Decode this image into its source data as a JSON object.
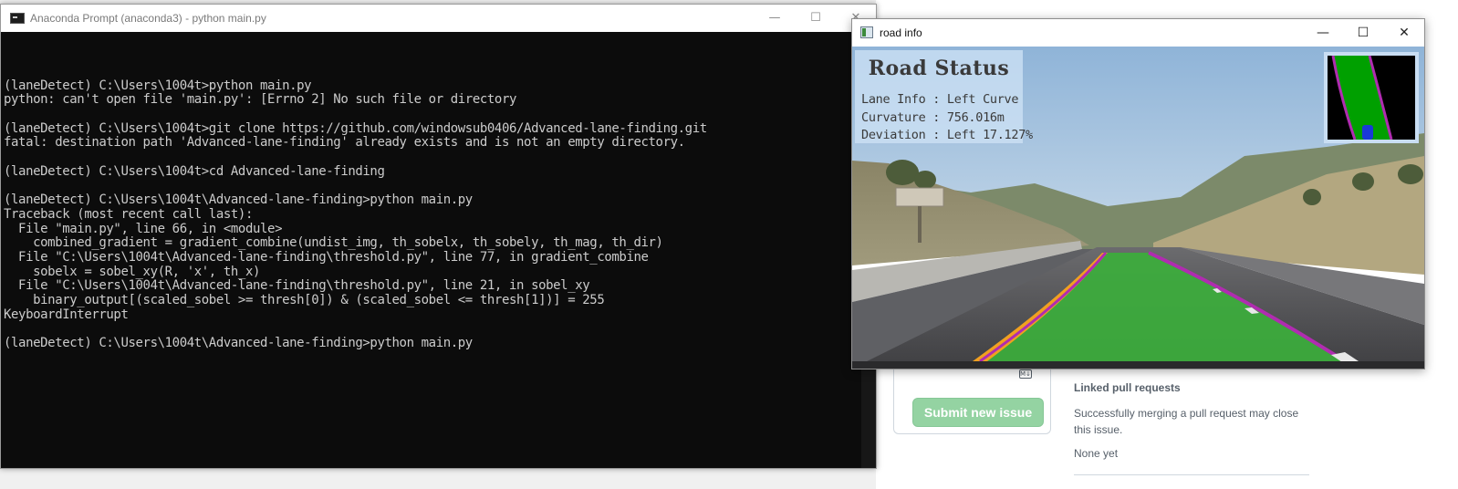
{
  "github": {
    "markdown_icon": "markdown-icon",
    "submit_label": "Submit new issue",
    "linked_pr_title": "Linked pull requests",
    "linked_pr_desc": "Successfully merging a pull request may close this issue.",
    "linked_pr_none": "None yet"
  },
  "console": {
    "title": "Anaconda Prompt (anaconda3) - python  main.py",
    "buttons": {
      "minimize": "—",
      "maximize": "☐",
      "close": "✕"
    },
    "lines": [
      "",
      "(laneDetect) C:\\Users\\1004t>python main.py",
      "python: can't open file 'main.py': [Errno 2] No such file or directory",
      "",
      "(laneDetect) C:\\Users\\1004t>git clone https://github.com/windowsub0406/Advanced-lane-finding.git",
      "fatal: destination path 'Advanced-lane-finding' already exists and is not an empty directory.",
      "",
      "(laneDetect) C:\\Users\\1004t>cd Advanced-lane-finding",
      "",
      "(laneDetect) C:\\Users\\1004t\\Advanced-lane-finding>python main.py",
      "Traceback (most recent call last):",
      "  File \"main.py\", line 66, in <module>",
      "    combined_gradient = gradient_combine(undist_img, th_sobelx, th_sobely, th_mag, th_dir)",
      "  File \"C:\\Users\\1004t\\Advanced-lane-finding\\threshold.py\", line 77, in gradient_combine",
      "    sobelx = sobel_xy(R, 'x', th_x)",
      "  File \"C:\\Users\\1004t\\Advanced-lane-finding\\threshold.py\", line 21, in sobel_xy",
      "    binary_output[(scaled_sobel >= thresh[0]) & (scaled_sobel <= thresh[1])] = 255",
      "KeyboardInterrupt",
      "",
      "(laneDetect) C:\\Users\\1004t\\Advanced-lane-finding>python main.py"
    ]
  },
  "road_window": {
    "title": "road info",
    "buttons": {
      "minimize": "—",
      "maximize": "☐",
      "close": "✕"
    },
    "status": {
      "heading": "Road Status",
      "lane_info": "Lane Info : Left Curve",
      "curvature": "Curvature : 756.016m",
      "deviation": "Deviation : Left 17.127%"
    }
  },
  "colors": {
    "lane_fill": "#3cae3c",
    "lane_edge": "#b02cb0",
    "left_line": "#f0a020",
    "console_bg": "#0c0c0c",
    "console_fg": "#cccccc"
  }
}
